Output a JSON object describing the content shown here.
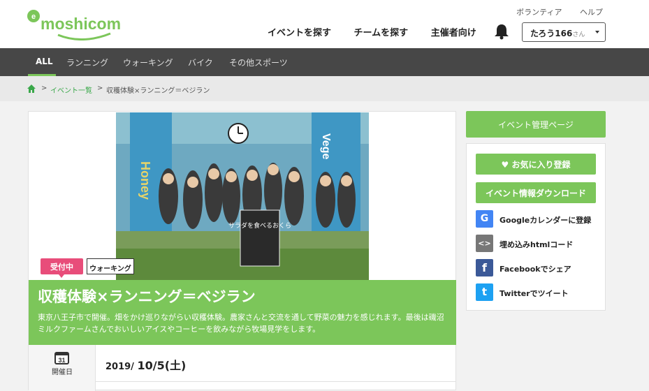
{
  "header": {
    "logo_text": "e-moshicom",
    "top_links": [
      "ボランティア",
      "ヘルプ"
    ],
    "nav": [
      "イベントを探す",
      "チームを探す",
      "主催者向け"
    ],
    "user": {
      "name": "たろう166",
      "suffix": "さん"
    }
  },
  "categories": [
    "ALL",
    "ランニング",
    "ウォーキング",
    "バイク",
    "その他スポーツ"
  ],
  "breadcrumb": {
    "sep": ">",
    "link": "イベント一覧",
    "current": "収穫体験×ランニング＝ベジラン"
  },
  "event": {
    "photo_signs": [
      "Honey",
      "Vege",
      "サラダを食べるおくら"
    ],
    "status_badge": "受付中",
    "type_badge": "ウォーキング",
    "title": "収穫体験×ランニング＝ベジラン",
    "description": "東京八王子市で開催。畑をかけ巡りながらい収穫体験。農家さんと交流を通して野菜の魅力を感じれます。最後は磯沼ミルクファームさんでおいしいアイスやコーヒーを飲みながら牧場見学をします。",
    "date_icon_number": "31",
    "date_label": "開催日",
    "date_year": "2019/",
    "date_main": "10/5(土)"
  },
  "sidebar": {
    "admin_button": "イベント管理ページ",
    "fav_button": "お気に入り登録",
    "download_button": "イベント情報ダウンロード",
    "share": [
      {
        "icon": "G",
        "label": "Googleカレンダーに登録",
        "color": "#4285f4"
      },
      {
        "icon": "<>",
        "label": "埋め込みhtmlコード",
        "color": "#777777"
      },
      {
        "icon": "f",
        "label": "Facebookでシェア",
        "color": "#3b5998"
      },
      {
        "icon": "t",
        "label": "Twitterでツイート",
        "color": "#1da1f2"
      }
    ]
  },
  "colors": {
    "accent": "#7cc65a",
    "badge": "#e84d7a",
    "dark_bar": "#474747"
  }
}
